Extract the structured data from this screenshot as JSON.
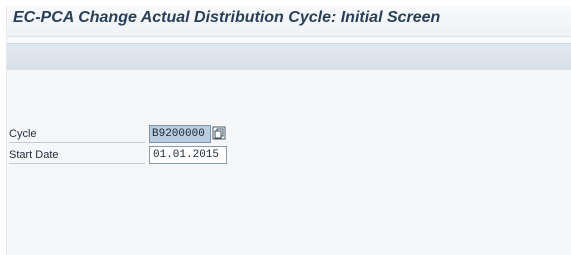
{
  "screen": {
    "title": "EC-PCA Change Actual Distribution Cycle: Initial Screen"
  },
  "form": {
    "cycle": {
      "label": "Cycle",
      "value": "B9200000",
      "search_help_icon": "copy-icon"
    },
    "start_date": {
      "label": "Start Date",
      "value": "01.01.2015"
    }
  },
  "colors": {
    "title_text": "#2a3f55",
    "selected_field": "#b9cde0",
    "toolbar": "#d6dee6"
  }
}
